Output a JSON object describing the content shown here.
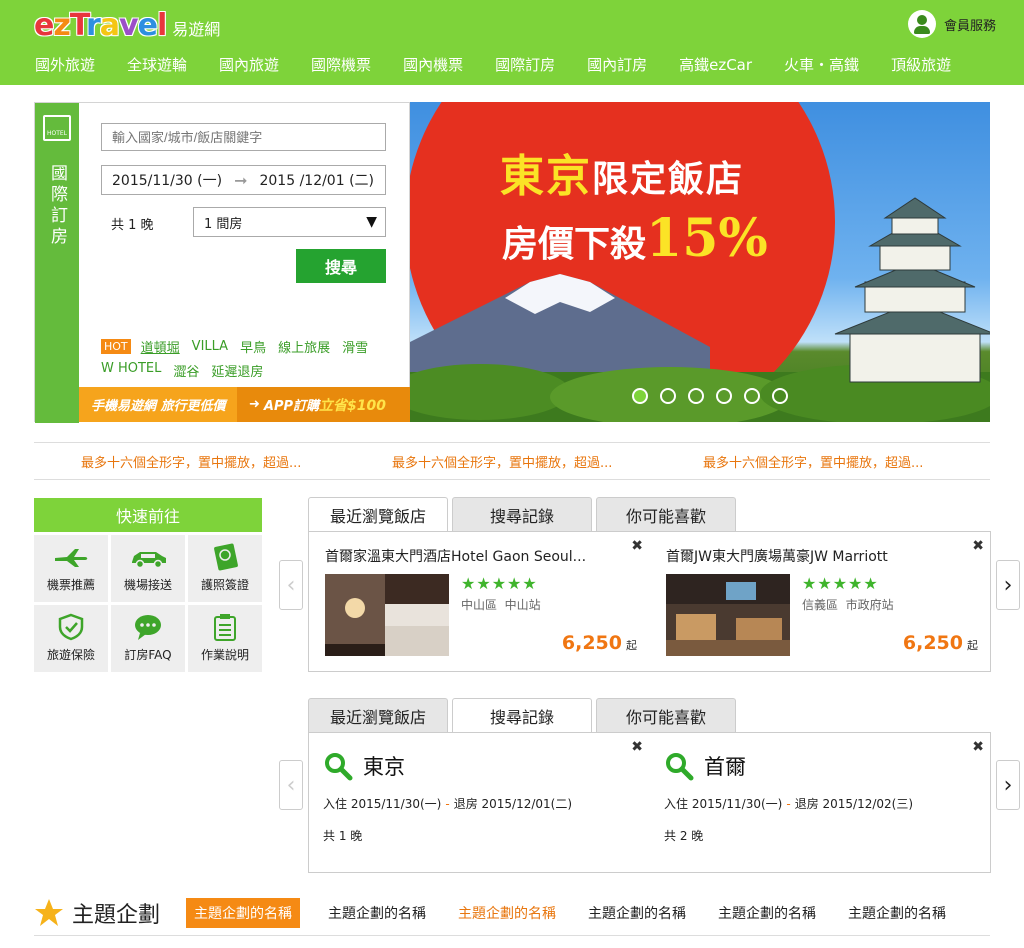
{
  "header": {
    "logo_text": "ezTravel",
    "logo_cn": "易遊網",
    "member_label": "會員服務",
    "nav": [
      "國外旅遊",
      "全球遊輪",
      "國內旅遊",
      "國際機票",
      "國內機票",
      "國際訂房",
      "國內訂房",
      "高鐵ezCar",
      "火車・高鐵",
      "頂級旅遊"
    ]
  },
  "search": {
    "side_badge": "HOTEL",
    "side_label": "國際訂房",
    "dest_placeholder": "輸入國家/城市/飯店關鍵字",
    "checkin": "2015/11/30 (一)",
    "checkout": "2015 /12/01 (二)",
    "nights": "共 1 晚",
    "rooms": "1 間房",
    "search_button": "搜尋",
    "hot_badge": "HOT",
    "keywords_row1": [
      "道頓堀",
      "VILLA",
      "早鳥",
      "線上旅展",
      "滑雪"
    ],
    "keywords_row2": [
      "W HOTEL",
      "澀谷",
      "延遲退房"
    ],
    "app_left": "手機易遊網 旅行更低價",
    "app_right_prefix": "APP訂購",
    "app_right_save": "立省$100"
  },
  "banner": {
    "line1_big": "東京",
    "line1_small": "限定飯店",
    "line2_text": "房價下殺",
    "line2_pct": "15%",
    "slide_count": 6,
    "active_slide": 1
  },
  "marquee": [
    "最多十六個全形字，置中擺放，超過...",
    "最多十六個全形字，置中擺放，超過...",
    "最多十六個全形字，置中擺放，超過..."
  ],
  "quick": {
    "title": "快速前往",
    "items": [
      {
        "label": "機票推薦",
        "icon": "airplane-icon"
      },
      {
        "label": "機場接送",
        "icon": "car-icon"
      },
      {
        "label": "護照簽證",
        "icon": "passport-icon"
      },
      {
        "label": "旅遊保險",
        "icon": "shield-icon"
      },
      {
        "label": "訂房FAQ",
        "icon": "chat-icon"
      },
      {
        "label": "作業說明",
        "icon": "clipboard-icon"
      }
    ]
  },
  "tabs": [
    "最近瀏覽飯店",
    "搜尋記錄",
    "你可能喜歡"
  ],
  "recent_hotels": [
    {
      "name": "首爾家溫東大門酒店Hotel Gaon Seoul...",
      "stars": "★★★★★",
      "area": "中山區",
      "station": "中山站",
      "price": "6,250",
      "unit": "起"
    },
    {
      "name": "首爾JW東大門廣場萬豪JW Marriott",
      "stars": "★★★★★",
      "area": "信義區",
      "station": "市政府站",
      "price": "6,250",
      "unit": "起"
    }
  ],
  "search_history": [
    {
      "city": "東京",
      "checkin": "入住 2015/11/30(一)",
      "checkout": "退房 2015/12/01(二)",
      "sep": "-",
      "nights": "共 1 晚"
    },
    {
      "city": "首爾",
      "checkin": "入住 2015/11/30(一)",
      "checkout": "退房 2015/12/02(三)",
      "sep": "-",
      "nights": "共 2 晚"
    }
  ],
  "theme": {
    "title": "主題企劃",
    "items": [
      "主題企劃的名稱",
      "主題企劃的名稱",
      "主題企劃的名稱",
      "主題企劃的名稱",
      "主題企劃的名稱",
      "主題企劃的名稱"
    ]
  },
  "colors": {
    "brand_green": "#7ed33a",
    "search_green": "#25a330",
    "accent_orange": "#f58a14",
    "banner_red": "#e5301f"
  }
}
